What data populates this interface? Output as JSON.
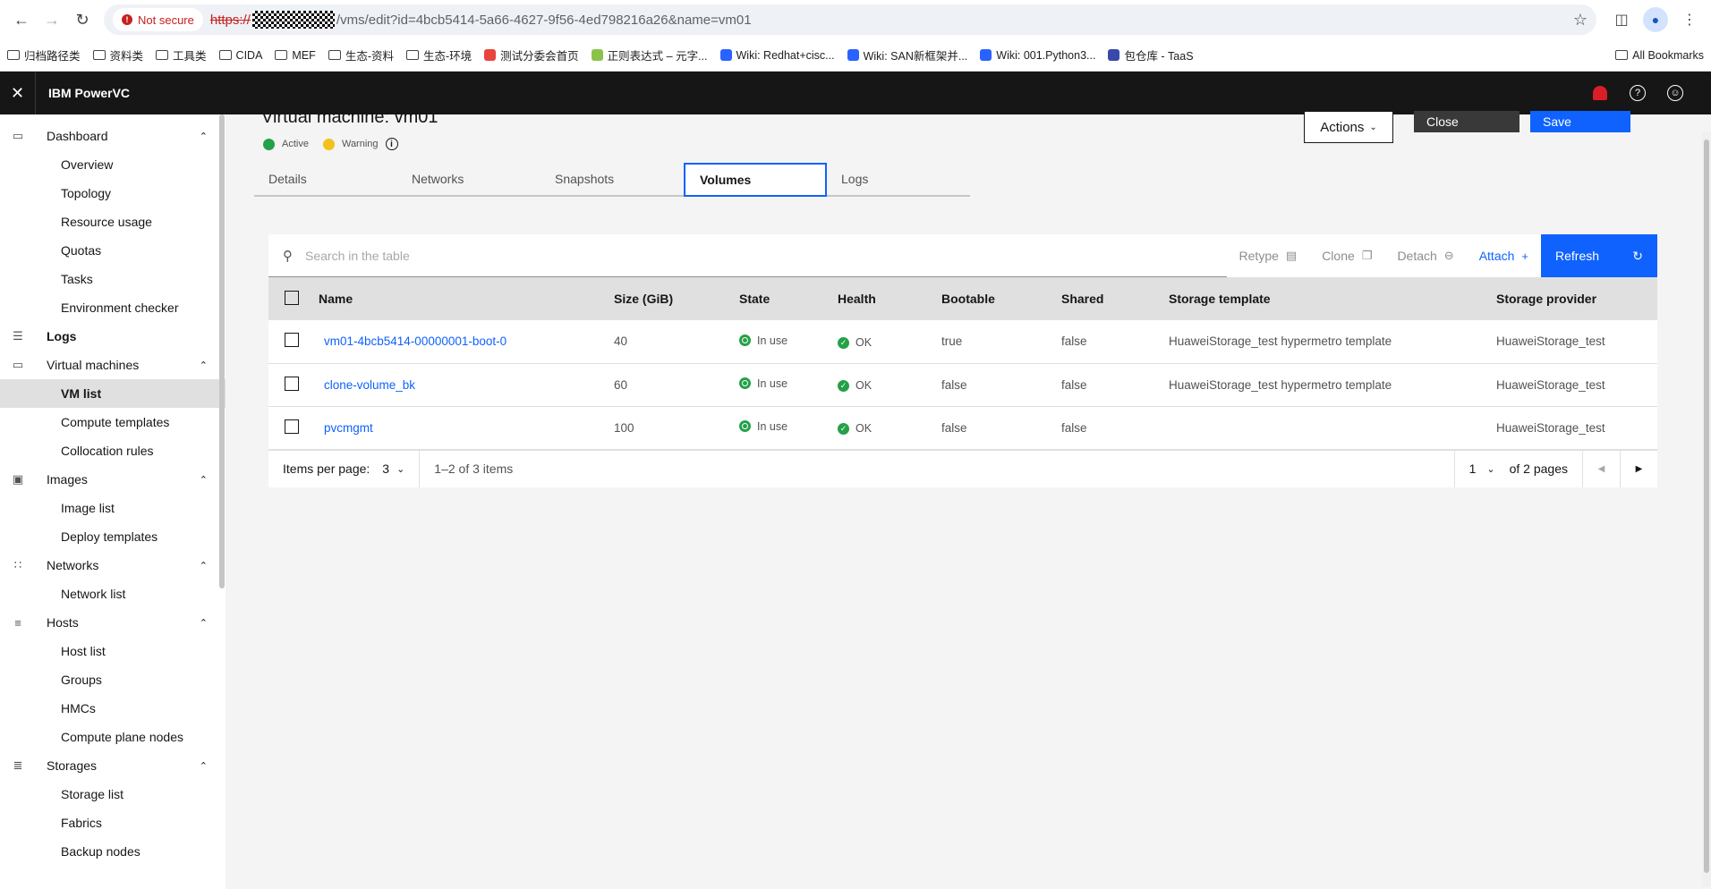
{
  "browser": {
    "security_label": "Not secure",
    "url_scheme": "https://",
    "url_rest": "/vms/edit?id=4bcb5414-5a66-4627-9f56-4ed798216a26&name=vm01",
    "bookmarks": [
      {
        "label": "归档路径类",
        "type": "folder"
      },
      {
        "label": "资料类",
        "type": "folder"
      },
      {
        "label": "工具类",
        "type": "folder"
      },
      {
        "label": "CIDA",
        "type": "folder"
      },
      {
        "label": "MEF",
        "type": "folder"
      },
      {
        "label": "生态-资料",
        "type": "folder"
      },
      {
        "label": "生态-环境",
        "type": "folder"
      },
      {
        "label": "测试分委会首页",
        "type": "site",
        "color": "#e8453c"
      },
      {
        "label": "正则表达式 – 元字...",
        "type": "site",
        "color": "#8bc34a"
      },
      {
        "label": "Wiki: Redhat+cisc...",
        "type": "site",
        "color": "#2962ff"
      },
      {
        "label": "Wiki: SAN新框架并...",
        "type": "site",
        "color": "#2962ff"
      },
      {
        "label": "Wiki: 001.Python3...",
        "type": "site",
        "color": "#2962ff"
      },
      {
        "label": "包仓库 - TaaS",
        "type": "site",
        "color": "#3949ab"
      }
    ],
    "all_bookmarks": "All Bookmarks"
  },
  "app": {
    "product_name": "IBM PowerVC"
  },
  "nav": [
    {
      "group": "Dashboard",
      "icon": "monitor-icon",
      "items": [
        "Overview",
        "Topology",
        "Resource usage",
        "Quotas",
        "Tasks",
        "Environment checker"
      ]
    },
    {
      "group": "Logs",
      "icon": "document-icon",
      "items": []
    },
    {
      "group": "Virtual machines",
      "icon": "monitor-icon",
      "items": [
        "VM list",
        "Compute templates",
        "Collocation rules"
      ],
      "active": "VM list"
    },
    {
      "group": "Images",
      "icon": "camera-icon",
      "items": [
        "Image list",
        "Deploy templates"
      ]
    },
    {
      "group": "Networks",
      "icon": "network-icon",
      "items": [
        "Network list"
      ]
    },
    {
      "group": "Hosts",
      "icon": "server-icon",
      "items": [
        "Host list",
        "Groups",
        "HMCs",
        "Compute plane nodes"
      ]
    },
    {
      "group": "Storages",
      "icon": "storage-icon",
      "items": [
        "Storage list",
        "Fabrics",
        "Backup nodes"
      ]
    }
  ],
  "page": {
    "title": "Virtual machine: vm01",
    "status_active": "Active",
    "status_warning": "Warning",
    "actions_label": "Actions",
    "close_label": "Close",
    "save_label": "Save",
    "tabs": [
      "Details",
      "Networks",
      "Snapshots",
      "Volumes",
      "Logs"
    ],
    "active_tab": "Volumes"
  },
  "toolbar": {
    "search_placeholder": "Search in the table",
    "retype": "Retype",
    "clone": "Clone",
    "detach": "Detach",
    "attach": "Attach",
    "refresh": "Refresh"
  },
  "table": {
    "headers": [
      "Name",
      "Size (GiB)",
      "State",
      "Health",
      "Bootable",
      "Shared",
      "Storage template",
      "Storage provider"
    ],
    "rows": [
      {
        "name": "vm01-4bcb5414-00000001-boot-0",
        "size": "40",
        "state": "In use",
        "health": "OK",
        "bootable": "true",
        "shared": "false",
        "template": "HuaweiStorage_test hypermetro template",
        "provider": "HuaweiStorage_test"
      },
      {
        "name": "clone-volume_bk",
        "size": "60",
        "state": "In use",
        "health": "OK",
        "bootable": "false",
        "shared": "false",
        "template": "HuaweiStorage_test hypermetro template",
        "provider": "HuaweiStorage_test"
      },
      {
        "name": "pvcmgmt",
        "size": "100",
        "state": "In use",
        "health": "OK",
        "bootable": "false",
        "shared": "false",
        "template": "",
        "provider": "HuaweiStorage_test"
      }
    ]
  },
  "pager": {
    "items_per_page_label": "Items per page:",
    "items_per_page": "3",
    "range": "1–2 of 3 items",
    "page": "1",
    "of_pages": "of 2 pages"
  }
}
